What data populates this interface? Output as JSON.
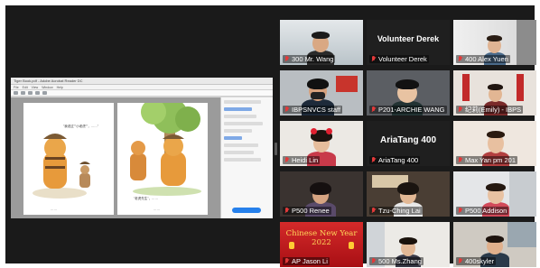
{
  "shared_screen": {
    "title_text": "Tiger Book.pdf - Adobe Acrobat Reader DC",
    "menu": [
      "File",
      "Edit",
      "View",
      "Window",
      "Help"
    ],
    "left_caption": "\"我说过\"\"小老虎\"\"，……\"",
    "right_caption": "\"老虎先生\"，……",
    "left_footer": "……",
    "right_footer": "……"
  },
  "participants": [
    {
      "id": "p1",
      "name": "300 Mr. Wang",
      "active_speaker": true,
      "muted": true
    },
    {
      "id": "p2",
      "name": "Volunteer Derek",
      "display_label": "Volunteer Derek",
      "muted": true,
      "video_off": true
    },
    {
      "id": "p3",
      "name": "400 Alex Yuen",
      "muted": true
    },
    {
      "id": "p4",
      "name": "IBPSNVCS staff",
      "muted": true
    },
    {
      "id": "p5",
      "name": "P201-ARCHIE WANG",
      "muted": true
    },
    {
      "id": "p6",
      "name": "纪莉(Emily) - IBPS",
      "muted": true
    },
    {
      "id": "p7",
      "name": "Heidi Lin",
      "muted": true
    },
    {
      "id": "p8",
      "name": "AriaTang 400",
      "display_label": "AriaTang 400",
      "muted": true,
      "video_off": true
    },
    {
      "id": "p9",
      "name": "Max Yan pm 201",
      "muted": true
    },
    {
      "id": "p10",
      "name": "P500 Renee",
      "muted": true
    },
    {
      "id": "p11",
      "name": "Tzu-Ching Lai",
      "muted": true
    },
    {
      "id": "p12",
      "name": "P500 Addison",
      "muted": true
    },
    {
      "id": "p13",
      "name": "AP Jason Li",
      "muted": true,
      "banner_text": "Chinese New Year 2022"
    },
    {
      "id": "p14",
      "name": "500 Ms.Zhang",
      "muted": true
    },
    {
      "id": "p15",
      "name": "400skyler",
      "muted": true
    }
  ],
  "colors": {
    "active_border": "#a8d84a",
    "muted_icon": "#e23a3a",
    "window_bg": "#1a1a1a"
  }
}
